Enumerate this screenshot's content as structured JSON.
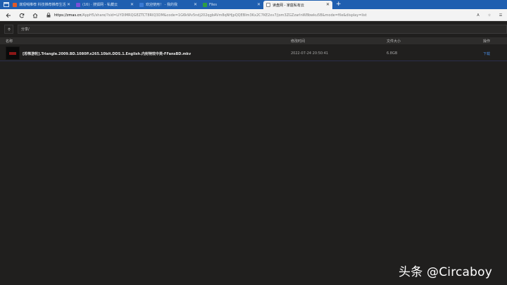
{
  "tabs": [
    {
      "label": "谋观哨推荐 科技推荐推荐生活",
      "fav_color": "#e05a2a",
      "active": false
    },
    {
      "label": "(16) · 搜狐网 - 私藏云",
      "fav_color": "#7a4fd9",
      "active": false
    },
    {
      "label": "欢迎使用！ - 我的我",
      "fav_color": "#3a7bd5",
      "active": false
    },
    {
      "label": "Files",
      "fav_color": "#2f9e44",
      "active": false
    },
    {
      "label": "读盘网 - 家庭私有云",
      "fav_color": "#ffffff",
      "active": true
    }
  ],
  "address": {
    "host": "https://zmas.cn",
    "rest": "/AppH5/share/?sid=LIYDIMRQGEZTCT8RIQ3DM&code=1G6kWv5ndj202qgbAVm8qNHjpQQEBIm3Kx2C7KE2xv7/jom3ZGZzarlnW8bwku5B&mode=file&display=list"
  },
  "breadcrumb": {
    "path": "分享/"
  },
  "table": {
    "headers": {
      "name": "名称",
      "modified": "修改时间",
      "size": "文件大小",
      "action": "操作"
    },
    "rows": [
      {
        "name": "[恐怖游轮].Triangle.2009.BD.1080P.x265.10bit.DDS.1.English.内封特效中英-FFansBD.mkv",
        "modified": "2022-07-24 20:50:41",
        "size": "6.8GB",
        "action": "下载"
      }
    ]
  },
  "watermark": "头条 @Circaboy"
}
